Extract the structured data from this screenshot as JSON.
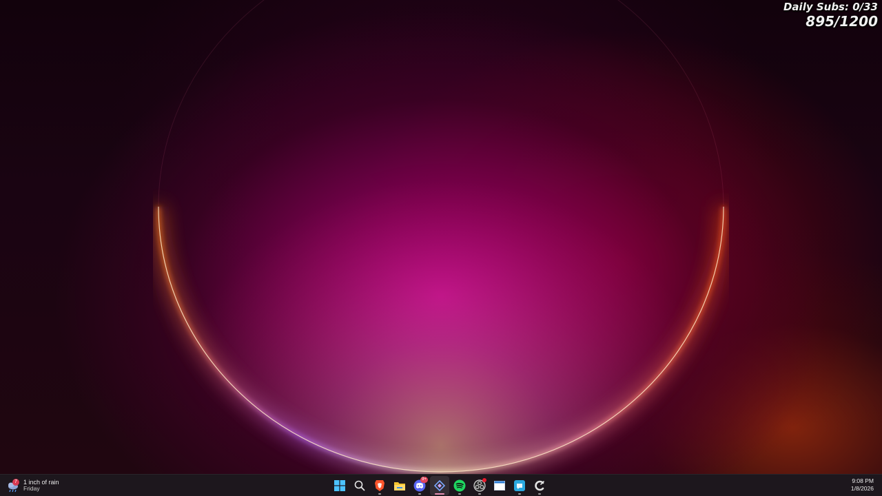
{
  "overlay": {
    "daily_subs": "Daily Subs: 0/33",
    "total_subs": "895/1200"
  },
  "weather": {
    "badge": "7",
    "line1": "1 inch of rain",
    "line2": "Friday",
    "icon": "rain-cloud-icon"
  },
  "taskbar": {
    "apps": [
      {
        "name": "start",
        "icon": "windows-logo-icon"
      },
      {
        "name": "search",
        "icon": "search-icon"
      },
      {
        "name": "brave",
        "icon": "brave-browser-icon",
        "open": true
      },
      {
        "name": "file-explorer",
        "icon": "folder-icon"
      },
      {
        "name": "discord",
        "icon": "discord-icon",
        "badge": "9+",
        "open": true
      },
      {
        "name": "vscode-like",
        "icon": "diamond-app-icon",
        "active": true
      },
      {
        "name": "spotify",
        "icon": "spotify-icon",
        "open": true
      },
      {
        "name": "obs",
        "icon": "obs-icon",
        "open": true
      },
      {
        "name": "window-app",
        "icon": "window-icon"
      },
      {
        "name": "sticky-app",
        "icon": "teal-app-icon",
        "open": true
      },
      {
        "name": "ccleaner",
        "icon": "ccleaner-icon",
        "open": true
      }
    ]
  },
  "clock": {
    "time": "9:08 PM",
    "date": "1/8/2026"
  },
  "colors": {
    "accent": "#e98fb3",
    "badge": "#e0435a",
    "taskbar": "#1e181e"
  }
}
